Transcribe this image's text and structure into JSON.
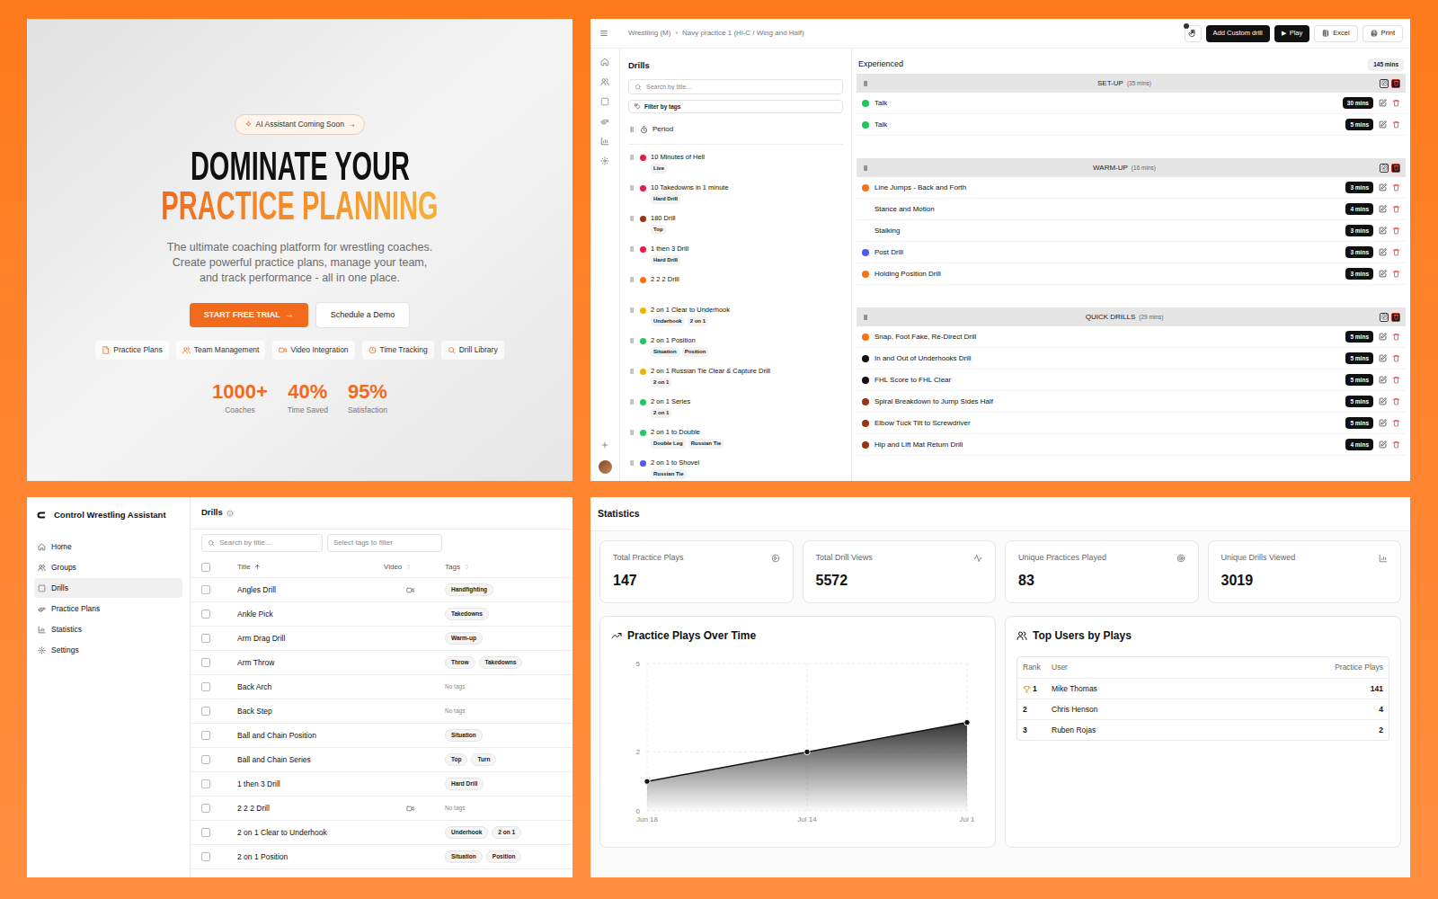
{
  "hero": {
    "badge": "AI Assistant Coming Soon",
    "badge_arrow": "→",
    "heading_line1": "DOMINATE YOUR",
    "heading_line2": "PRACTICE PLANNING",
    "subtitle": "The ultimate coaching platform for wrestling coaches. Create powerful practice plans, manage your team, and track performance - all in one place.",
    "primary_button": "START FREE TRIAL",
    "primary_arrow": "→",
    "secondary_button": "Schedule a Demo",
    "features": [
      "Practice Plans",
      "Team Management",
      "Video Integration",
      "Time Tracking",
      "Drill Library"
    ],
    "stats": [
      {
        "value": "1000+",
        "label": "Coaches"
      },
      {
        "value": "40%",
        "label": "Time Saved"
      },
      {
        "value": "95%",
        "label": "Satisfaction"
      }
    ]
  },
  "planner": {
    "breadcrumb": [
      "Wrestling (M)",
      "Navy practice 1 (Hi-C / Wing and Half)"
    ],
    "separator": "›",
    "toolbar_badge": true,
    "buttons": [
      {
        "label": "Add Custom drill",
        "glyph": "",
        "kind": "dark"
      },
      {
        "label": "Play",
        "glyph": "▶",
        "kind": "dark"
      },
      {
        "label": "Excel",
        "glyph": "",
        "kind": "light"
      },
      {
        "label": "Print",
        "glyph": "",
        "kind": "light"
      }
    ],
    "drills_panel": {
      "title": "Drills",
      "search_placeholder": "Search by title...",
      "filter_button": "Filter by tags",
      "period_label": "Period",
      "items": [
        {
          "title": "10 Minutes of Hell",
          "tags": [
            "Live"
          ],
          "color": "#e11d48"
        },
        {
          "title": "10 Takedowns in 1 minute",
          "tags": [
            "Hard Drill"
          ],
          "color": "#e11d48"
        },
        {
          "title": "180 Drill",
          "tags": [
            "Top"
          ],
          "color": "#9a3412"
        },
        {
          "title": "1 then 3 Drill",
          "tags": [
            "Hard Drill"
          ],
          "color": "#e11d48"
        },
        {
          "title": "2 2 2 Drill",
          "tags": [],
          "color": "#f97316"
        },
        {
          "title": "2 on 1 Clear to Underhook",
          "tags": [
            "Underhook",
            "2 on 1"
          ],
          "color": "#eab308"
        },
        {
          "title": "2 on 1 Position",
          "tags": [
            "Situation",
            "Position"
          ],
          "color": "#22c55e"
        },
        {
          "title": "2 on 1 Russian Tie Clear & Capture Drill",
          "tags": [
            "2 on 1"
          ],
          "color": "#eab308"
        },
        {
          "title": "2 on 1 Series",
          "tags": [
            "2 on 1"
          ],
          "color": "#22c55e"
        },
        {
          "title": "2 on 1 to Double",
          "tags": [
            "Double Leg",
            "Russian Tie"
          ],
          "color": "#22c55e"
        },
        {
          "title": "2 on 1 to Shovel",
          "tags": [
            "Russian Tie"
          ],
          "color": "#4f5bea"
        }
      ]
    },
    "plan": {
      "title": "Experienced",
      "total": "145 mins",
      "sections": [
        {
          "title": "SET-UP",
          "duration": "(35 mins)",
          "drills": [
            {
              "title": "Talk",
              "duration": "30 mins",
              "color": "#22c55e"
            },
            {
              "title": "Talk",
              "duration": "5 mins",
              "color": "#22c55e"
            }
          ]
        },
        {
          "title": "WARM-UP",
          "duration": "(16 mins)",
          "drills": [
            {
              "title": "Line Jumps - Back and Forth",
              "duration": "3 mins",
              "color": "#f97316"
            },
            {
              "title": "Stance and Motion",
              "duration": "4 mins"
            },
            {
              "title": "Stalking",
              "duration": "3 mins"
            },
            {
              "title": "Post Drill",
              "duration": "3 mins",
              "color": "#4f5bea"
            },
            {
              "title": "Holding Position Drill",
              "duration": "3 mins",
              "color": "#f97316"
            }
          ]
        },
        {
          "title": "QUICK DRILLS",
          "duration": "(29 mins)",
          "drills": [
            {
              "title": "Snap, Foot Fake, Re-Direct Drill",
              "duration": "5 mins",
              "color": "#f97316"
            },
            {
              "title": "In and Out of Underhooks Drill",
              "duration": "5 mins",
              "color": "#111111"
            },
            {
              "title": "FHL Score to FHL Clear",
              "duration": "5 mins",
              "color": "#111111"
            },
            {
              "title": "Spiral Breakdown to Jump Sides Half",
              "duration": "5 mins",
              "color": "#9a3412"
            },
            {
              "title": "Elbow Tuck Tilt to Screwdriver",
              "duration": "5 mins",
              "color": "#9a3412"
            },
            {
              "title": "Hip and Lift Mat Return Drill",
              "duration": "4 mins",
              "color": "#9a3412"
            }
          ]
        }
      ]
    }
  },
  "admin": {
    "app_name": "Control Wrestling Assistant",
    "nav": [
      {
        "label": "Home",
        "selected": false
      },
      {
        "label": "Groups",
        "selected": false
      },
      {
        "label": "Drills",
        "selected": true
      },
      {
        "label": "Practice Plans",
        "selected": false
      },
      {
        "label": "Statistics",
        "selected": false
      },
      {
        "label": "Settings",
        "selected": false
      }
    ],
    "page_title": "Drills",
    "search_placeholder": "Search by title...",
    "tags_placeholder": "Select tags to filter",
    "header_checked": false,
    "columns": [
      {
        "label": "Title",
        "sort": "asc"
      },
      {
        "label": "Video",
        "sort": "none"
      },
      {
        "label": "Tags",
        "sort": "none"
      }
    ],
    "no_tags_label": "No tags",
    "rows": [
      {
        "title": "Angles Drill",
        "video": true,
        "tags": [
          "Handfighting"
        ],
        "checked": false
      },
      {
        "title": "Ankle Pick",
        "video": false,
        "tags": [
          "Takedowns"
        ],
        "checked": false
      },
      {
        "title": "Arm Drag Drill",
        "video": false,
        "tags": [
          "Warm-up"
        ],
        "checked": false
      },
      {
        "title": "Arm Throw",
        "video": false,
        "tags": [
          "Throw",
          "Takedowns"
        ],
        "checked": false
      },
      {
        "title": "Back Arch",
        "video": false,
        "tags": [],
        "checked": false
      },
      {
        "title": "Back Step",
        "video": false,
        "tags": [],
        "checked": false
      },
      {
        "title": "Ball and Chain Position",
        "video": false,
        "tags": [
          "Situation"
        ],
        "checked": false
      },
      {
        "title": "Ball and Chain Series",
        "video": false,
        "tags": [
          "Top",
          "Turn"
        ],
        "checked": false
      },
      {
        "title": "1 then 3 Drill",
        "video": false,
        "tags": [
          "Hard Drill"
        ],
        "checked": false
      },
      {
        "title": "2 2 2 Drill",
        "video": true,
        "tags": [],
        "checked": false
      },
      {
        "title": "2 on 1 Clear to Underhook",
        "video": false,
        "tags": [
          "Underhook",
          "2 on 1"
        ],
        "checked": false
      },
      {
        "title": "2 on 1 Position",
        "video": false,
        "tags": [
          "Situation",
          "Position"
        ],
        "checked": false
      }
    ]
  },
  "statistics": {
    "title": "Statistics",
    "cards": [
      {
        "label": "Total Practice Plays",
        "value": "147"
      },
      {
        "label": "Total Drill Views",
        "value": "5572"
      },
      {
        "label": "Unique Practices Played",
        "value": "83"
      },
      {
        "label": "Unique Drills Viewed",
        "value": "3019"
      }
    ],
    "chart": {
      "title": "Practice Plays Over Time",
      "y_ticks": [
        "5",
        "2",
        "0"
      ],
      "x_labels": [
        "Jun 18",
        "Jul 14",
        "Jul 1"
      ],
      "values": [
        1,
        2,
        3
      ]
    },
    "top_users": {
      "title": "Top Users by Plays",
      "columns": [
        "Rank",
        "User",
        "Practice Plays"
      ],
      "rows": [
        {
          "rank": "1",
          "user": "Mike Thomas",
          "plays": "141",
          "trophy": true
        },
        {
          "rank": "2",
          "user": "Chris Henson",
          "plays": "4",
          "trophy": false
        },
        {
          "rank": "3",
          "user": "Ruben Rojas",
          "plays": "2",
          "trophy": false
        }
      ]
    }
  }
}
